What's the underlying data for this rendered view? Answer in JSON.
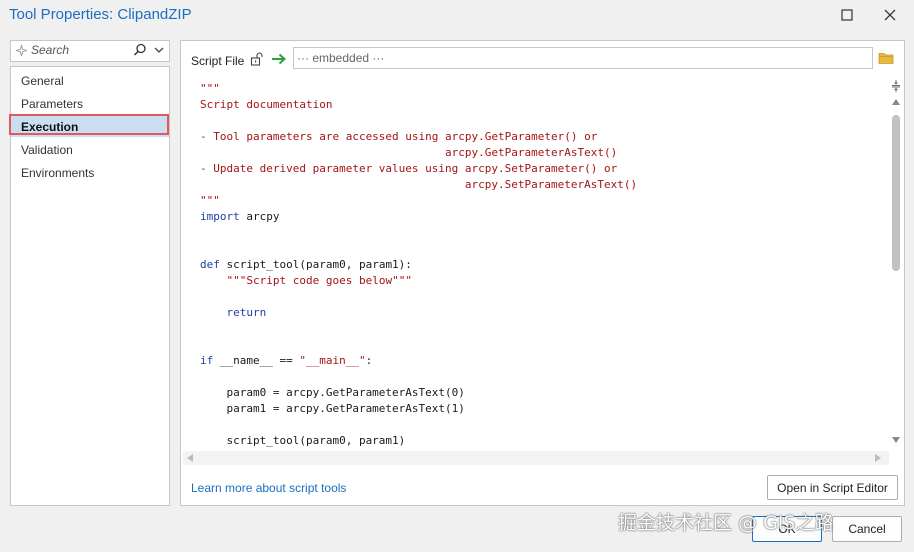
{
  "window": {
    "title": "Tool Properties: ClipandZIP",
    "restore_icon": "maximize-icon",
    "close_icon": "close-icon"
  },
  "search": {
    "placeholder": "Search"
  },
  "nav": {
    "items": [
      {
        "label": "General",
        "selected": false
      },
      {
        "label": "Parameters",
        "selected": false
      },
      {
        "label": "Execution",
        "selected": true
      },
      {
        "label": "Validation",
        "selected": false
      },
      {
        "label": "Environments",
        "selected": false
      }
    ]
  },
  "script": {
    "label": "Script File",
    "path_value": "··· embedded ···"
  },
  "code_lines": [
    "\"\"\"",
    "Script documentation",
    "",
    "- Tool parameters are accessed using arcpy.GetParameter() or",
    "                                     arcpy.GetParameterAsText()",
    "- Update derived parameter values using arcpy.SetParameter() or",
    "                                        arcpy.SetParameterAsText()",
    "\"\"\"",
    "import arcpy",
    "",
    "",
    "def script_tool(param0, param1):",
    "    \"\"\"Script code goes below\"\"\"",
    "",
    "    return",
    "",
    "",
    "if __name__ == \"__main__\":",
    "",
    "    param0 = arcpy.GetParameterAsText(0)",
    "    param1 = arcpy.GetParameterAsText(1)",
    "",
    "    script_tool(param0, param1)"
  ],
  "footer": {
    "learn_more": "Learn more about script tools",
    "open_in_editor": "Open in Script Editor"
  },
  "buttons": {
    "ok": "OK",
    "cancel": "Cancel"
  },
  "watermark": "掘金技术社区 @ GIS之路",
  "colors": {
    "accent": "#1b6ec2",
    "selection": "#c9dff1",
    "highlight_border": "#e0595d",
    "string": "#a31515",
    "keyword": "#1f3ea8"
  }
}
